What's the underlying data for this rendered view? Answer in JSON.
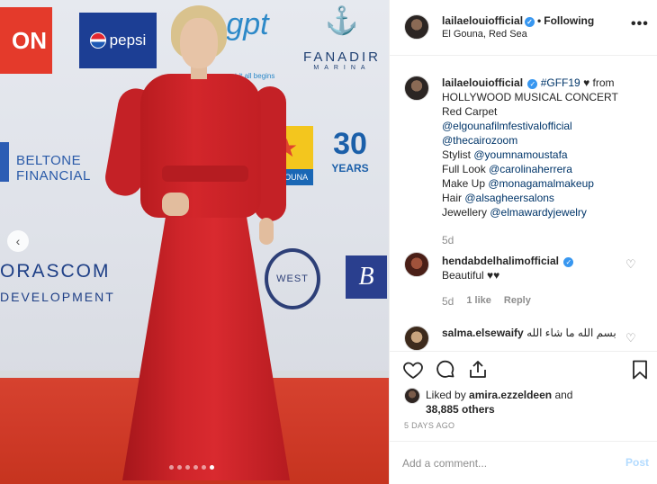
{
  "photo": {
    "sponsor_logos": [
      "ON",
      "pepsi",
      "gpt",
      "put it all begins",
      "FANADIR",
      "MARINA",
      "BELTONE FINANCIAL",
      "EL GOUNA",
      "30",
      "YEARS",
      "ORASCOM",
      "DEVELOPMENT",
      "WEST",
      "B"
    ],
    "carousel_dots": 6,
    "active_dot": 5
  },
  "header": {
    "username": "lailaelouiofficial",
    "follow_status": "Following",
    "location": "El Gouna, Red Sea",
    "more": "•••"
  },
  "caption": {
    "username": "lailaelouiofficial",
    "hashtag": "#GFF19",
    "heart": "♥",
    "line1_rest": "from",
    "line2": "HOLLYWOOD MUSICAL CONCERT",
    "line3": "Red Carpet",
    "mention1": "@elgounafilmfestivalofficial",
    "mention2": "@thecairozoom",
    "stylist_label": "Stylist",
    "stylist": "@youmnamoustafa",
    "look_label": "Full Look",
    "look": "@carolinaherrera",
    "makeup_label": "Make Up",
    "makeup": "@monagamalmakeup",
    "hair_label": "Hair",
    "hair": "@alsagheersalons",
    "jewellery_label": "Jewellery",
    "jewellery": "@elmawardyjewelry",
    "time": "5d"
  },
  "comments": [
    {
      "username": "hendabdelhalimofficial",
      "text": "Beautiful ♥♥",
      "time": "5d",
      "likes": "1 like",
      "reply": "Reply"
    },
    {
      "username": "salma.elsewaify",
      "text": "بسم الله ما شاء الله"
    }
  ],
  "actions": {
    "liked_by_prefix": "Liked by",
    "liked_by_user": "amira.ezzeldeen",
    "liked_by_and": "and",
    "others": "38,885 others",
    "date": "5 DAYS AGO"
  },
  "add_comment": {
    "placeholder": "Add a comment...",
    "post_label": "Post"
  },
  "colors": {
    "link": "#003569",
    "verified": "#3897f0",
    "muted": "#8e8e8e",
    "post_disabled": "#b3dbff",
    "dress": "#d3262b",
    "carpet": "#cf3a28"
  }
}
